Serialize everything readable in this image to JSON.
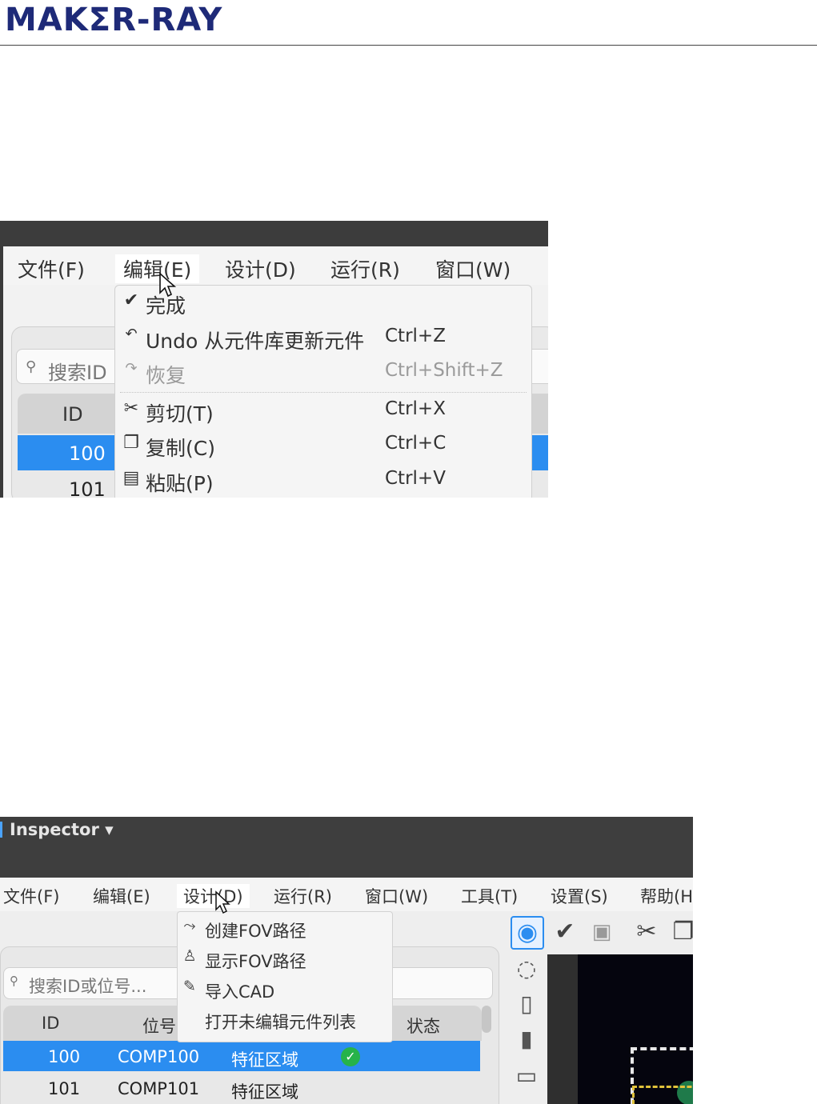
{
  "header": {
    "logo_text": "MAKΣR-RAY"
  },
  "screenshot1": {
    "menubar": [
      "文件(F)",
      "编辑(E)",
      "设计(D)",
      "运行(R)",
      "窗口(W)"
    ],
    "search_placeholder": "搜索ID",
    "table": {
      "header_id": "ID",
      "rows": [
        "100",
        "101"
      ]
    },
    "edit_menu": {
      "items": [
        {
          "icon": "check-icon",
          "label": "完成",
          "shortcut": ""
        },
        {
          "icon": "undo-icon",
          "label": "Undo 从元件库更新元件",
          "shortcut": "Ctrl+Z"
        },
        {
          "icon": "redo-icon",
          "label": "恢复",
          "shortcut": "Ctrl+Shift+Z",
          "disabled": true
        },
        {
          "icon": "scissors-icon",
          "label": "剪切(T)",
          "shortcut": "Ctrl+X"
        },
        {
          "icon": "copy-icon",
          "label": "复制(C)",
          "shortcut": "Ctrl+C"
        },
        {
          "icon": "paste-icon",
          "label": "粘贴(P)",
          "shortcut": "Ctrl+V"
        }
      ]
    }
  },
  "screenshot2": {
    "window_title": "Inspector ▾",
    "menubar": [
      "文件(F)",
      "编辑(E)",
      "设计(D)",
      "运行(R)",
      "窗口(W)",
      "工具(T)",
      "设置(S)",
      "帮助(H"
    ],
    "search_placeholder": "搜索ID或位号...",
    "table": {
      "headers": {
        "id": "ID",
        "ref": "位号",
        "status": "状态"
      },
      "rows": [
        {
          "id": "100",
          "ref": "COMP100",
          "type": "特征区域",
          "status": "ok",
          "selected": true
        },
        {
          "id": "101",
          "ref": "COMP101",
          "type": "特征区域",
          "status": "",
          "selected": false
        }
      ]
    },
    "design_menu": {
      "items": [
        {
          "icon": "path-icon",
          "label": "创建FOV路径"
        },
        {
          "icon": "person-icon",
          "label": "显示FOV路径"
        },
        {
          "icon": "edit-icon",
          "label": "导入CAD"
        },
        {
          "icon": "",
          "label": "打开未编辑元件列表"
        }
      ]
    },
    "toolbar": [
      "target-icon",
      "check-icon",
      "save-icon",
      "scissors-icon",
      "copy-icon"
    ],
    "side_tools": [
      "dotted-circle-icon",
      "component-icon",
      "chip-icon",
      "rectangle-icon"
    ]
  },
  "colors": {
    "selection": "#2b8df0",
    "status_ok": "#26b34a",
    "logo": "#1e2a78"
  }
}
